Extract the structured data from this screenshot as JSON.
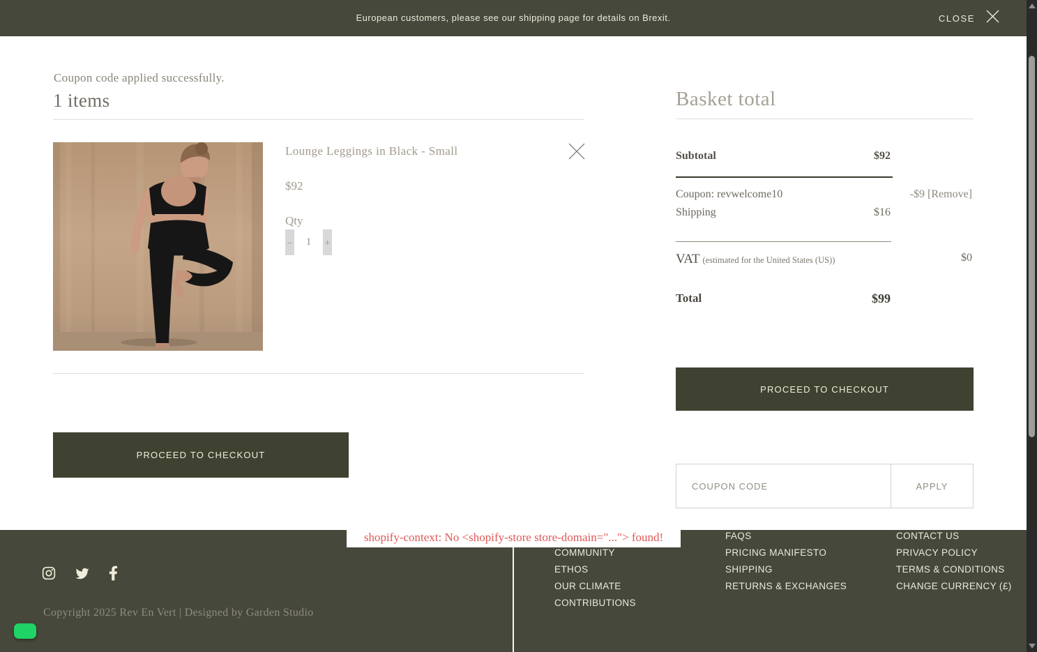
{
  "colors": {
    "olive": "#45483a",
    "button_olive": "#3f4231",
    "cream_text": "#f1eedd",
    "error_red": "#e05858",
    "green_badge": "#1fd366"
  },
  "banner": {
    "message": "European customers, please see our shipping page for details on Brexit.",
    "close_label": "CLOSE"
  },
  "cart": {
    "status_message": "Coupon code applied successfully.",
    "items_heading": "1 items",
    "item": {
      "title": "Lounge Leggings in Black - Small",
      "price": "$92",
      "qty_label": "Qty",
      "qty_value": "1",
      "decrease_label": "–",
      "increase_label": "+"
    },
    "checkout_label": "PROCEED TO CHECKOUT"
  },
  "summary": {
    "title": "Basket total",
    "rows": {
      "subtotal": {
        "label": "Subtotal",
        "value": "$92"
      },
      "coupon": {
        "label": "Coupon: revwelcome10",
        "value": "-$9 [Remove]"
      },
      "shipping": {
        "label": "Shipping",
        "value": "$16"
      },
      "vat": {
        "label": "VAT",
        "note": "(estimated for the United States (US))",
        "value": "$0"
      },
      "total": {
        "label": "Total",
        "value": "$99"
      }
    },
    "checkout_label": "PROCEED TO CHECKOUT",
    "coupon_placeholder": "COUPON CODE",
    "apply_label": "APPLY"
  },
  "error_overlay": {
    "text": "shopify-context: No <shopify-store store-domain=\"...\"> found!"
  },
  "footer": {
    "social": [
      {
        "name": "instagram"
      },
      {
        "name": "twitter"
      },
      {
        "name": "facebook"
      }
    ],
    "columns": [
      {
        "items": [
          "COMMUNITY",
          "ETHOS",
          "OUR CLIMATE",
          "CONTRIBUTIONS"
        ]
      },
      {
        "items": [
          "FAQS",
          "PRICING MANIFESTO",
          "SHIPPING",
          "RETURNS & EXCHANGES"
        ]
      },
      {
        "items": [
          "CONTACT US",
          "PRIVACY POLICY",
          "TERMS & CONDITIONS",
          "CHANGE CURRENCY (£)"
        ]
      }
    ],
    "copyright": "Copyright 2025 Rev En Vert | Designed by Garden Studio"
  }
}
